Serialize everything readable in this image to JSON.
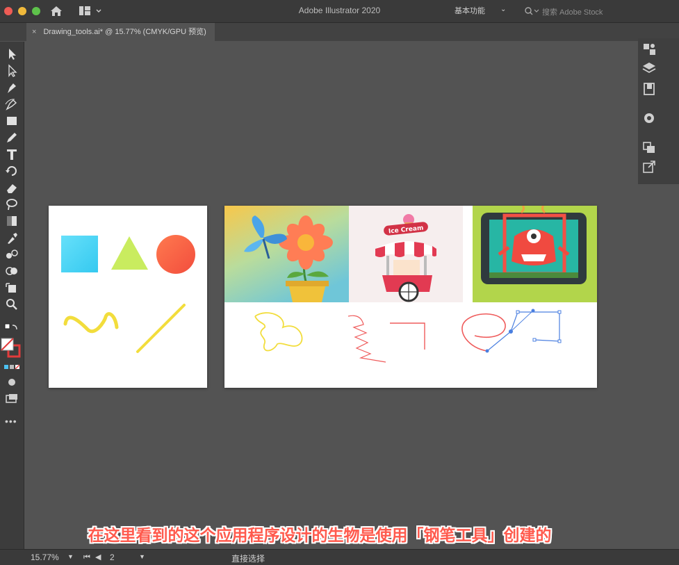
{
  "window": {
    "title": "Adobe Illustrator 2020",
    "workspace_label": "基本功能",
    "search_placeholder": "搜索 Adobe Stock"
  },
  "document_tab": {
    "close_glyph": "×",
    "label": "Drawing_tools.ai* @ 15.77% (CMYK/GPU 预览)"
  },
  "tools": [
    {
      "icon": "selection-tool-icon"
    },
    {
      "icon": "direct-selection-tool-icon"
    },
    {
      "icon": "pen-tool-icon"
    },
    {
      "icon": "curvature-tool-icon"
    },
    {
      "icon": "rectangle-tool-icon"
    },
    {
      "icon": "pencil-tool-icon"
    },
    {
      "icon": "type-tool-icon"
    },
    {
      "icon": "rotate-tool-icon"
    },
    {
      "icon": "eraser-tool-icon"
    },
    {
      "icon": "lasso-tool-icon"
    },
    {
      "icon": "gradient-tool-icon"
    },
    {
      "icon": "eyedropper-tool-icon"
    },
    {
      "icon": "blend-tool-icon"
    },
    {
      "icon": "shape-builder-tool-icon"
    },
    {
      "icon": "artboard-tool-icon"
    },
    {
      "icon": "zoom-tool-icon"
    }
  ],
  "colors": {
    "app_background": "#535353",
    "cyan_square": "#4dd8f5",
    "green_triangle": "#c9ec5f",
    "orange_circle": "#fb6a45",
    "yellow_stroke": "#f2dd3c",
    "red_sketch": "#ef5b5b",
    "path_blue": "#4a7fe0",
    "caption_red": "#ff5a4d"
  },
  "artwork": {
    "ice_cream_sign": "Ice Cream"
  },
  "status": {
    "zoom": "15.77%",
    "nav_glyphs": "⏮ ◀",
    "page": "2",
    "current_tool": "直接选择"
  },
  "caption": "在这里看到的这个应用程序设计的生物是使用「钢笔工具」创建的"
}
